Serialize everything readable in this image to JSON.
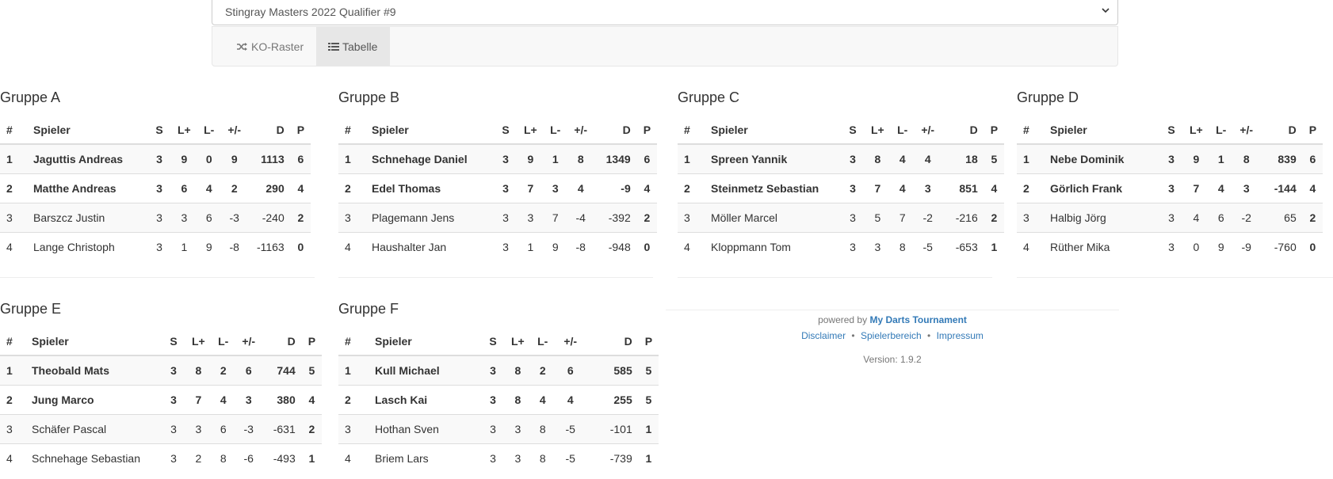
{
  "tournament_select": {
    "value": "Stingray Masters 2022 Qualifier #9"
  },
  "tabs": [
    {
      "label": "KO-Raster",
      "icon": "shuffle-icon",
      "active": false
    },
    {
      "label": "Tabelle",
      "icon": "list-icon",
      "active": true
    }
  ],
  "columns": [
    "#",
    "Spieler",
    "S",
    "L+",
    "L-",
    "+/-",
    "D",
    "P"
  ],
  "groups": [
    {
      "title": "Gruppe A",
      "rows": [
        [
          "1",
          "Jaguttis Andreas",
          "3",
          "9",
          "0",
          "9",
          "1113",
          "6"
        ],
        [
          "2",
          "Matthe Andreas",
          "3",
          "6",
          "4",
          "2",
          "290",
          "4"
        ],
        [
          "3",
          "Barszcz Justin",
          "3",
          "3",
          "6",
          "-3",
          "-240",
          "2"
        ],
        [
          "4",
          "Lange Christoph",
          "3",
          "1",
          "9",
          "-8",
          "-1163",
          "0"
        ]
      ]
    },
    {
      "title": "Gruppe B",
      "rows": [
        [
          "1",
          "Schnehage Daniel",
          "3",
          "9",
          "1",
          "8",
          "1349",
          "6"
        ],
        [
          "2",
          "Edel Thomas",
          "3",
          "7",
          "3",
          "4",
          "-9",
          "4"
        ],
        [
          "3",
          "Plagemann Jens",
          "3",
          "3",
          "7",
          "-4",
          "-392",
          "2"
        ],
        [
          "4",
          "Haushalter Jan",
          "3",
          "1",
          "9",
          "-8",
          "-948",
          "0"
        ]
      ]
    },
    {
      "title": "Gruppe C",
      "rows": [
        [
          "1",
          "Spreen Yannik",
          "3",
          "8",
          "4",
          "4",
          "18",
          "5"
        ],
        [
          "2",
          "Steinmetz Sebastian",
          "3",
          "7",
          "4",
          "3",
          "851",
          "4"
        ],
        [
          "3",
          "Möller Marcel",
          "3",
          "5",
          "7",
          "-2",
          "-216",
          "2"
        ],
        [
          "4",
          "Kloppmann Tom",
          "3",
          "3",
          "8",
          "-5",
          "-653",
          "1"
        ]
      ]
    },
    {
      "title": "Gruppe D",
      "rows": [
        [
          "1",
          "Nebe Dominik",
          "3",
          "9",
          "1",
          "8",
          "839",
          "6"
        ],
        [
          "2",
          "Görlich Frank",
          "3",
          "7",
          "4",
          "3",
          "-144",
          "4"
        ],
        [
          "3",
          "Halbig Jörg",
          "3",
          "4",
          "6",
          "-2",
          "65",
          "2"
        ],
        [
          "4",
          "Rüther Mika",
          "3",
          "0",
          "9",
          "-9",
          "-760",
          "0"
        ]
      ]
    },
    {
      "title": "Gruppe E",
      "rows": [
        [
          "1",
          "Theobald Mats",
          "3",
          "8",
          "2",
          "6",
          "744",
          "5"
        ],
        [
          "2",
          "Jung Marco",
          "3",
          "7",
          "4",
          "3",
          "380",
          "4"
        ],
        [
          "3",
          "Schäfer Pascal",
          "3",
          "3",
          "6",
          "-3",
          "-631",
          "2"
        ],
        [
          "4",
          "Schnehage Sebastian",
          "3",
          "2",
          "8",
          "-6",
          "-493",
          "1"
        ]
      ]
    },
    {
      "title": "Gruppe F",
      "rows": [
        [
          "1",
          "Kull Michael",
          "3",
          "8",
          "2",
          "6",
          "585",
          "5"
        ],
        [
          "2",
          "Lasch Kai",
          "3",
          "8",
          "4",
          "4",
          "255",
          "5"
        ],
        [
          "3",
          "Hothan Sven",
          "3",
          "3",
          "8",
          "-5",
          "-101",
          "1"
        ],
        [
          "4",
          "Briem Lars",
          "3",
          "3",
          "8",
          "-5",
          "-739",
          "1"
        ]
      ]
    }
  ],
  "footer": {
    "powered_by": "powered by",
    "brand": "My Darts Tournament",
    "links": [
      "Disclaimer",
      "Spielerbereich",
      "Impressum"
    ],
    "separator": "•",
    "version": "Version: 1.9.2"
  }
}
